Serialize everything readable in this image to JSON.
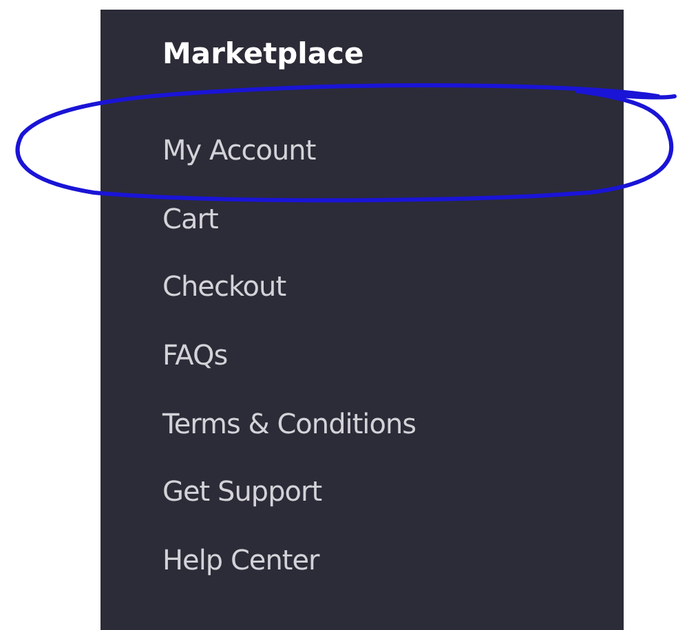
{
  "menu": {
    "title": "Marketplace",
    "items": [
      {
        "label": "My Account"
      },
      {
        "label": "Cart"
      },
      {
        "label": "Checkout"
      },
      {
        "label": "FAQs"
      },
      {
        "label": "Terms & Conditions"
      },
      {
        "label": "Get Support"
      },
      {
        "label": "Help Center"
      }
    ]
  }
}
